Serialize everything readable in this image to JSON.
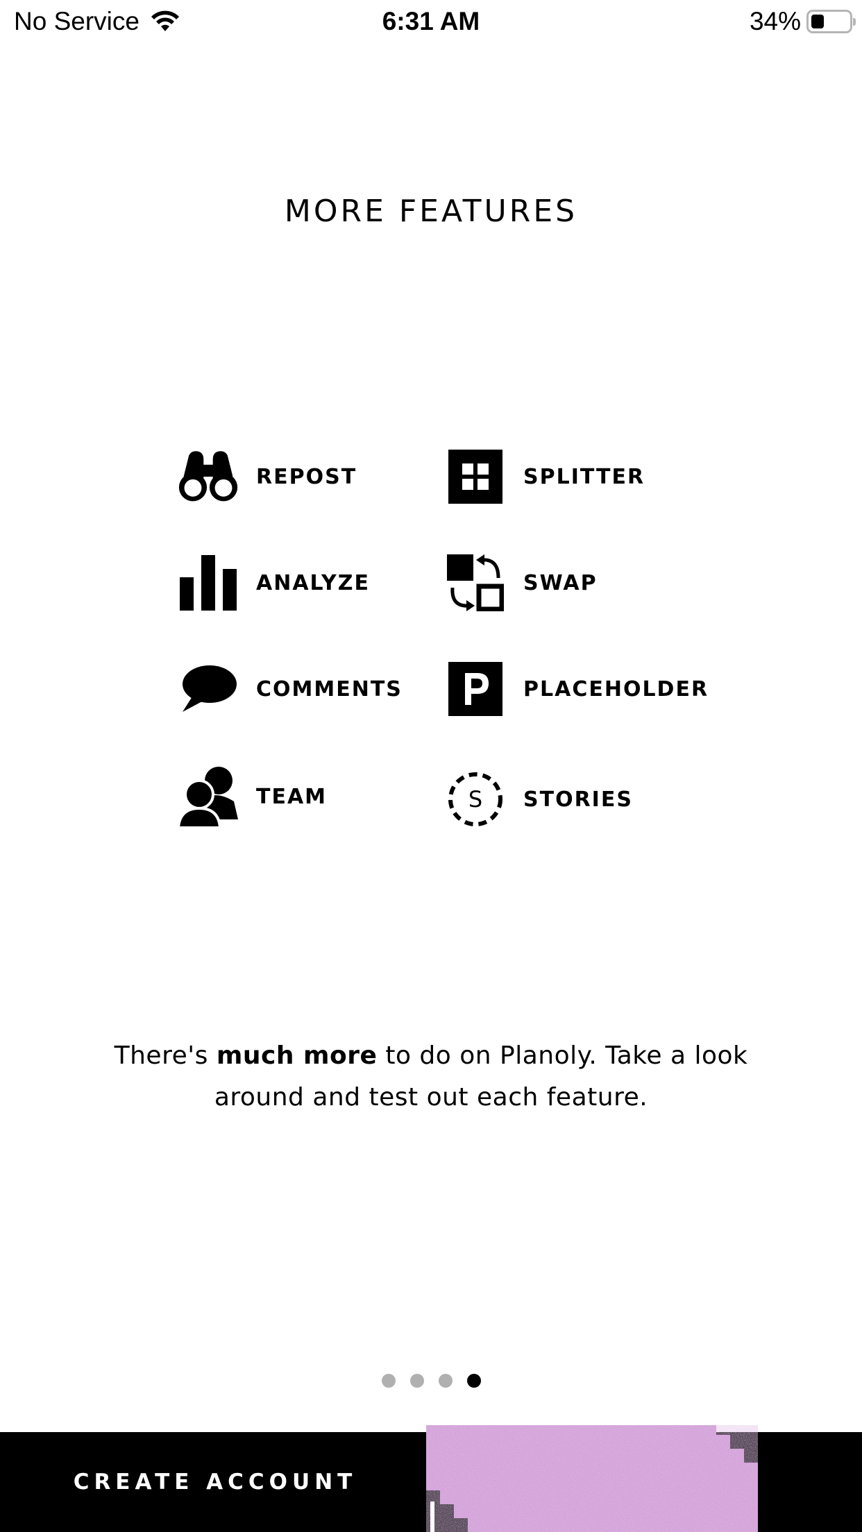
{
  "status_bar": {
    "carrier": "No Service",
    "time": "6:31 AM",
    "battery_percent": "34%",
    "battery_level": 0.34
  },
  "title": "MORE FEATURES",
  "title_highlight_color": "#f8e8de",
  "features": [
    {
      "label": "REPOST",
      "icon": "binoculars-icon"
    },
    {
      "label": "SPLITTER",
      "icon": "grid-icon"
    },
    {
      "label": "ANALYZE",
      "icon": "bar-chart-icon"
    },
    {
      "label": "SWAP",
      "icon": "swap-icon"
    },
    {
      "label": "COMMENTS",
      "icon": "speech-bubble-icon"
    },
    {
      "label": "PLACEHOLDER",
      "icon": "placeholder-p-icon"
    },
    {
      "label": "TEAM",
      "icon": "team-icon"
    },
    {
      "label": "STORIES",
      "icon": "stories-icon"
    }
  ],
  "description": {
    "before": "There's ",
    "bold": "much more",
    "after": " to do on Planoly. Take a look around and test out each feature."
  },
  "pagination": {
    "total": 4,
    "active_index": 3
  },
  "bottom": {
    "create_account_label": "CREATE ACCOUNT",
    "glitter_color": "#c98fd0"
  }
}
